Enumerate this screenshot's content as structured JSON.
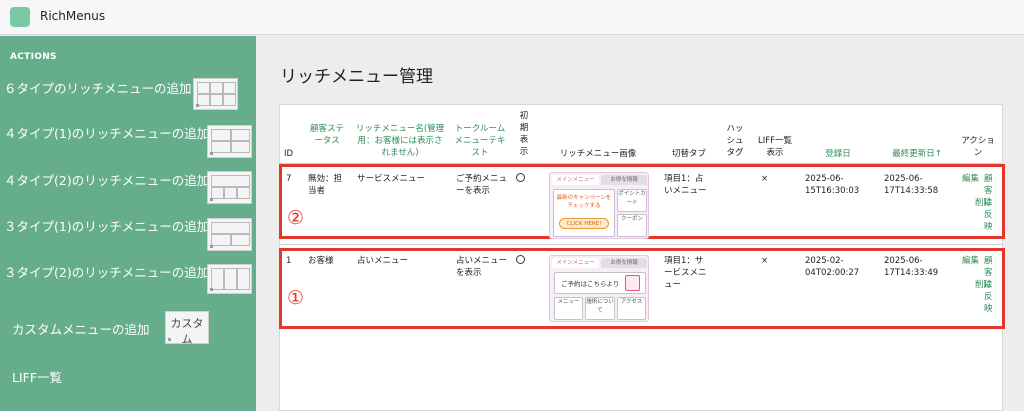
{
  "app": {
    "title": "RichMenus"
  },
  "sidebar": {
    "heading": "ACTIONS",
    "actions": [
      "６タイプのリッチメニューの追加",
      "４タイプ(1)のリッチメニューの追加",
      "４タイプ(2)のリッチメニューの追加",
      "３タイプ(1)のリッチメニューの追加",
      "３タイプ(2)のリッチメニューの追加",
      "カスタムメニューの追加",
      "LIFF一覧"
    ],
    "custom_thumb_label": "カスタム"
  },
  "page": {
    "title": "リッチメニュー管理"
  },
  "table": {
    "headers": {
      "id": "ID",
      "status": "顧客ステータス",
      "name": "リッチメニュー名(管理用：お客様には表示されません)",
      "talk": "トークルームメニューテキスト",
      "initial": "初期表示",
      "image": "リッチメニュー画像",
      "switch": "切替タブ",
      "hashtag": "ハッシュタグ",
      "liff": "LIFF一覧表示",
      "created": "登録日",
      "updated": "最終更新日↑",
      "action": "アクション"
    },
    "rows": [
      {
        "id": "7",
        "status": "無効：担当者",
        "name": "サービスメニュー",
        "talk": "ご予約メニューを表示",
        "initial": "○",
        "switch": "項目1：占いメニュー",
        "liff": "×",
        "created": "2025-06-15T16:30:03",
        "updated": "2025-06-17T14:33:58",
        "actions": [
          "編集",
          "顧客に反映",
          "削除"
        ],
        "badge": "②",
        "image": {
          "tab1": "メインメニュー",
          "tab2": "お得な情報",
          "banner": "最新のキャンペーンをチェックする",
          "cta": "CLICK HERE!",
          "side1": "ポイントカード",
          "side2": "クーポン"
        }
      },
      {
        "id": "1",
        "status": "お客様",
        "name": "占いメニュー",
        "talk": "占いメニューを表示",
        "initial": "○",
        "switch": "項目1：サービスメニュー",
        "liff": "×",
        "created": "2025-02-04T02:00:27",
        "updated": "2025-06-17T14:33:49",
        "actions": [
          "編集",
          "顧客に反映",
          "削除"
        ],
        "badge": "①",
        "image": {
          "tab1": "メインメニュー",
          "tab2": "お得な情報",
          "banner": "ご予約はこちらより",
          "b1": "メニュー",
          "b2": "施術について",
          "b3": "アクセス"
        }
      }
    ]
  },
  "colors": {
    "sidebar": "#66ad8c",
    "accent_green": "#2e8b57",
    "highlight_red": "#e5362c"
  }
}
